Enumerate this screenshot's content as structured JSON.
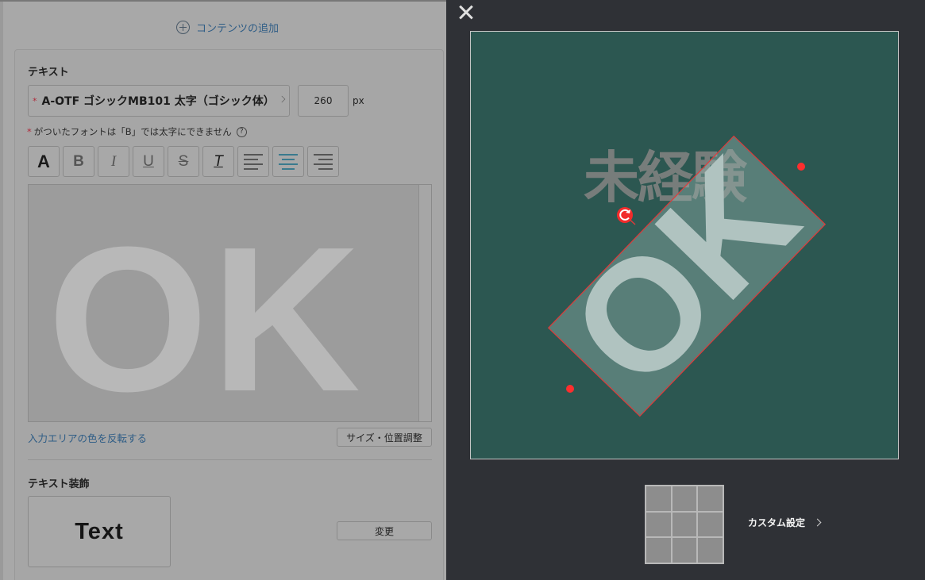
{
  "left_panel": {
    "add_content_label": "コンテンツの追加",
    "text_section_title": "テキスト",
    "font_required_mark": "*",
    "font_name": "A-OTF ゴシックMB101 太字（ゴシック体）",
    "font_size_value": "260",
    "font_size_unit": "px",
    "note_star": "*",
    "note_text": "がついたフォントは「B」では太字にできません",
    "help_icon": "?",
    "toolbar": {
      "font_icon": "A",
      "bold_icon": "B",
      "italic_icon": "I",
      "underline_icon": "U",
      "strike_icon": "S",
      "clear_format_icon": "T"
    },
    "editor_text": "OK",
    "invert_link": "入力エリアの色を反転する",
    "size_position_button": "サイズ・位置調整",
    "decoration_title": "テキスト装飾",
    "decoration_preview": "Text",
    "change_button": "変更"
  },
  "right_panel": {
    "canvas_heading_text": "未経験",
    "canvas_rotated_text": "OK",
    "custom_settings_label": "カスタム設定"
  },
  "colors": {
    "canvas_bg": "#2c5751",
    "selection_border": "#e03a3a",
    "handle": "#ff2e2e",
    "link": "#2f5d86"
  }
}
